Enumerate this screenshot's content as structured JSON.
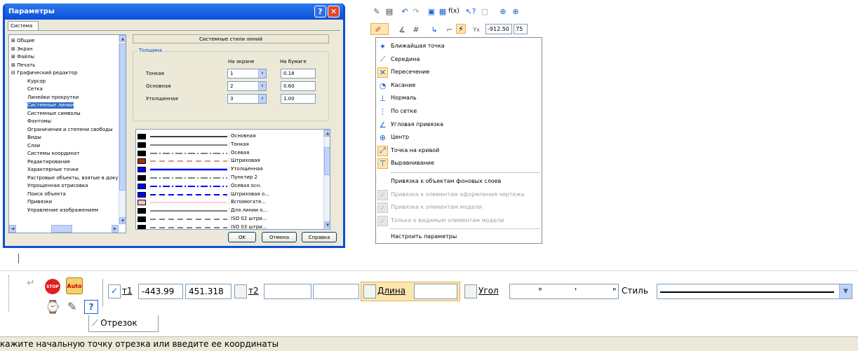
{
  "dialog": {
    "title": "Параметры",
    "help_btn": "?",
    "close_btn": "✕",
    "tab": "Система",
    "tree": [
      {
        "label": "Общие",
        "marker": "⊞"
      },
      {
        "label": "Экран",
        "marker": "⊞"
      },
      {
        "label": "Файлы",
        "marker": "⊞"
      },
      {
        "label": "Печать",
        "marker": "⊞"
      },
      {
        "label": "Графический редактор",
        "marker": "⊟"
      },
      {
        "label": "Курсор"
      },
      {
        "label": "Сетка"
      },
      {
        "label": "Линейки прокрутки"
      },
      {
        "label": "Системные линии",
        "selected": true
      },
      {
        "label": "Системные символы"
      },
      {
        "label": "Фантомы"
      },
      {
        "label": "Ограничения и степени свободы"
      },
      {
        "label": "Виды"
      },
      {
        "label": "Слои"
      },
      {
        "label": "Системы координат"
      },
      {
        "label": "Редактирование"
      },
      {
        "label": "Характерные точки"
      },
      {
        "label": "Растровые объекты, взятые в документ"
      },
      {
        "label": "Упрощенная отрисовка"
      },
      {
        "label": "Поиск объекта"
      },
      {
        "label": "Привязки"
      },
      {
        "label": "Управление изображением"
      }
    ],
    "header": "Системные стили линий",
    "group_title": "Толщина",
    "col_screen": "На экране",
    "col_paper": "На бумаге",
    "rows": [
      {
        "label": "Тонкая",
        "screen": "1",
        "paper": "0.18"
      },
      {
        "label": "Основная",
        "screen": "2",
        "paper": "0.60"
      },
      {
        "label": "Утолщенная",
        "screen": "3",
        "paper": "1.00"
      }
    ],
    "styles": [
      {
        "name": "Основная",
        "color": "#000000",
        "line": "solid",
        "width": 1.5,
        "lcolor": "#000"
      },
      {
        "name": "Тонкая",
        "color": "#000000",
        "line": "solid",
        "width": 1,
        "lcolor": "#000"
      },
      {
        "name": "Осевая",
        "color": "#000000",
        "line": "dashdot",
        "width": 1,
        "lcolor": "#000"
      },
      {
        "name": "Штриховая",
        "color": "#a0300a",
        "line": "dashed",
        "width": 1,
        "lcolor": "#a0300a"
      },
      {
        "name": "Утолщенная",
        "color": "#0000ff",
        "line": "solid",
        "width": 2.5,
        "lcolor": "#0000ff"
      },
      {
        "name": "Пунктир 2",
        "color": "#000000",
        "line": "dashdot",
        "width": 1,
        "lcolor": "#000"
      },
      {
        "name": "Осевая осн.",
        "color": "#0000ff",
        "line": "dashdot",
        "width": 2,
        "lcolor": "#0000ff"
      },
      {
        "name": "Штриховая о...",
        "color": "#0000ff",
        "line": "dashed",
        "width": 2,
        "lcolor": "#0000ff"
      },
      {
        "name": "Вспомогате...",
        "color": "#ffc0cb",
        "line": "solid",
        "width": 1,
        "lcolor": "#ff99aa"
      },
      {
        "name": "Для линии о...",
        "color": "#000000",
        "line": "solid",
        "width": 1,
        "lcolor": "#000"
      },
      {
        "name": "ISO 02 штри...",
        "color": "#000000",
        "line": "dashed",
        "width": 1,
        "lcolor": "#000"
      },
      {
        "name": "ISO 03 штри...",
        "color": "#000000",
        "line": "dashed",
        "width": 1,
        "lcolor": "#000"
      }
    ],
    "ok": "OK",
    "cancel": "Отмена",
    "help": "Справка"
  },
  "toolbar": {
    "x_value": "-912.50",
    "y_value": "75"
  },
  "menu": {
    "items": [
      {
        "label": "Ближайшая точка",
        "icon": "✦",
        "enabled": true
      },
      {
        "label": "Середина",
        "icon": "⟋",
        "enabled": true
      },
      {
        "label": "Пересечение",
        "icon": "✕",
        "enabled": true,
        "checked": true
      },
      {
        "label": "Касание",
        "icon": "◔",
        "enabled": true
      },
      {
        "label": "Нормаль",
        "icon": "⊥",
        "enabled": true
      },
      {
        "label": "По сетке",
        "icon": "⋮",
        "enabled": true
      },
      {
        "label": "Угловая привязка",
        "icon": "∠",
        "enabled": true
      },
      {
        "label": "Центр",
        "icon": "⊕",
        "enabled": true
      },
      {
        "label": "Точка на кривой",
        "icon": "⤢",
        "enabled": true,
        "checked": true
      },
      {
        "label": "Выравнивание",
        "icon": "⊤",
        "enabled": true,
        "checked": true
      }
    ],
    "items2": [
      {
        "label": "Привязка к объектам фоновых слоев",
        "enabled": true
      },
      {
        "label": "Привязка к элементам оформления чертежа",
        "enabled": false
      },
      {
        "label": "Привязка к элементам модели",
        "enabled": false
      },
      {
        "label": "Только к видимым элементам модели",
        "enabled": false
      }
    ],
    "configure": "Настроить параметры"
  },
  "panel": {
    "stop": "STOP",
    "auto": "Auto",
    "t1": "т1",
    "t1_x": "-443.99",
    "t1_y": "451.318",
    "t2": "т2",
    "length": "Длина",
    "angle": "Угол",
    "angle_deg": "°",
    "angle_min": "'",
    "angle_sec": "\"",
    "style": "Стиль",
    "tab": "Отрезок"
  },
  "status": "кажите начальную точку отрезка или введите ее координаты"
}
